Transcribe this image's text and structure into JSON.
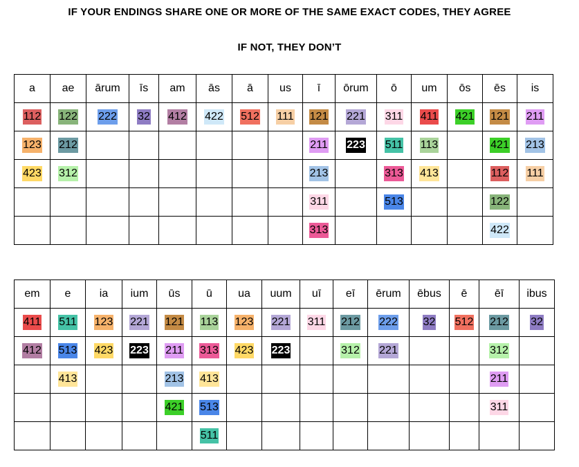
{
  "header": {
    "line1": "IF YOUR ENDINGS SHARE ONE OR MORE OF THE SAME EXACT CODES, THEY AGREE",
    "line2": "IF NOT, THEY DON’T"
  },
  "colors": {
    "111": "#f6cfa5",
    "112": "#dc5f5f",
    "113": "#a9d39a",
    "121": "#c48b45",
    "122": "#88b47a",
    "123": "#f6b26b",
    "211": "#df9cf3",
    "212": "#6c9aa2",
    "213": "#a2c3e6",
    "221": "#b4a7d6",
    "222": "#6d9eeb",
    "223": "#000000",
    "311": "#fdd7e6",
    "312": "#b6f1aa",
    "313": "#ec5a97",
    "32": "#8e7cc3",
    "411": "#ea4b4b",
    "412": "#b27ea3",
    "413": "#ffe599",
    "421": "#3ccf28",
    "422": "#cfe8f8",
    "423": "#ffd966",
    "511": "#45c2a6",
    "512": "#f0705f",
    "513": "#4a86e8"
  },
  "colWidths1": [
    52,
    52,
    62,
    43,
    54,
    52,
    52,
    50,
    47,
    60,
    50,
    52,
    51,
    50,
    52
  ],
  "colWidths2": [
    52,
    51,
    53,
    50,
    51,
    50,
    51,
    55,
    48,
    50,
    60,
    58,
    43,
    58,
    51
  ],
  "table1": {
    "headers": [
      "a",
      "ae",
      "ārum",
      "īs",
      "am",
      "ās",
      "ā",
      "us",
      "ī",
      "ōrum",
      "ō",
      "um",
      "ōs",
      "ēs",
      "is"
    ],
    "rows": [
      [
        "112",
        "122",
        "222",
        "32",
        "412",
        "422",
        "512",
        "111",
        "121",
        "221",
        "311",
        "411",
        "421",
        "121",
        "211"
      ],
      [
        "123",
        "212",
        "",
        "",
        "",
        "",
        "",
        "",
        "211",
        "223",
        "511",
        "113",
        "",
        "421",
        "213"
      ],
      [
        "423",
        "312",
        "",
        "",
        "",
        "",
        "",
        "",
        "213",
        "",
        "313",
        "413",
        "",
        "112",
        "111"
      ],
      [
        "",
        "",
        "",
        "",
        "",
        "",
        "",
        "",
        "311",
        "",
        "513",
        "",
        "",
        "122",
        ""
      ],
      [
        "",
        "",
        "",
        "",
        "",
        "",
        "",
        "",
        "313",
        "",
        "",
        "",
        "",
        "422",
        ""
      ]
    ]
  },
  "table2": {
    "headers": [
      "em",
      "e",
      "ia",
      "ium",
      "ūs",
      "ū",
      "ua",
      "uum",
      "uī",
      "eī",
      "ērum",
      "ēbus",
      "ē",
      "ēī",
      "ibus"
    ],
    "rows": [
      [
        "411",
        "511",
        "123",
        "221",
        "121",
        "113",
        "123",
        "221",
        "311",
        "212",
        "222",
        "32",
        "512",
        "212",
        "32"
      ],
      [
        "412",
        "513",
        "423",
        "223",
        "211",
        "313",
        "423",
        "223",
        "",
        "312",
        "221",
        "",
        "",
        "312",
        ""
      ],
      [
        "",
        "413",
        "",
        "",
        "213",
        "413",
        "",
        "",
        "",
        "",
        "",
        "",
        "",
        "211",
        ""
      ],
      [
        "",
        "",
        "",
        "",
        "421",
        "513",
        "",
        "",
        "",
        "",
        "",
        "",
        "",
        "311",
        ""
      ],
      [
        "",
        "",
        "",
        "",
        "",
        "511",
        "",
        "",
        "",
        "",
        "",
        "",
        "",
        "",
        ""
      ]
    ]
  }
}
